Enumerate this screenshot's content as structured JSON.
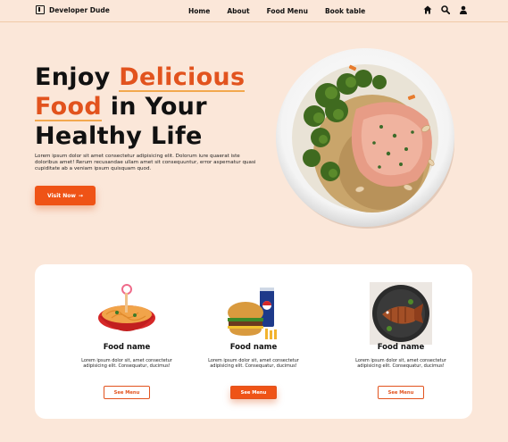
{
  "nav": {
    "brand": "Developer Dude",
    "items": [
      {
        "label": "Home"
      },
      {
        "label": "About"
      },
      {
        "label": "Food Menu"
      },
      {
        "label": "Book table"
      }
    ],
    "icons": [
      "home-icon",
      "search-icon",
      "user-icon"
    ]
  },
  "hero": {
    "title_part1": "Enjoy",
    "title_highlight1": "Delicious",
    "title_highlight2": "Food",
    "title_part2": "in Your",
    "title_part3": "Healthy Life",
    "text": "Lorem ipsum dolor sit amet consectetur adipisicing elit. Dolorum iure quaerat iste doloribus amet! Rerum recusandae ullam amet sit consequuntur, error aspernatur quasi cupiditate ab a veniam ipsum quisquam quod.",
    "button_label": "Visit Now",
    "button_arrow": "→"
  },
  "cards": [
    {
      "name": "Food name",
      "desc": "Lorem ipsum dolor sit, amet consectetur adipisicing elit. Consequatur, ducimus!",
      "button": "See Menu",
      "active": false,
      "image": "noodle-bowl"
    },
    {
      "name": "Food name",
      "desc": "Lorem ipsum dolor sit, amet consectetur adipisicing elit. Consequatur, ducimus!",
      "button": "See Menu",
      "active": true,
      "image": "burger-soda"
    },
    {
      "name": "Food name",
      "desc": "Lorem ipsum dolor sit, amet consectetur adipisicing elit. Consequatur, ducimus!",
      "button": "See Menu",
      "active": false,
      "image": "fish-plate"
    }
  ],
  "colors": {
    "accent": "#ef5316",
    "background": "#fbe7d9",
    "underline": "#f3a84e"
  }
}
